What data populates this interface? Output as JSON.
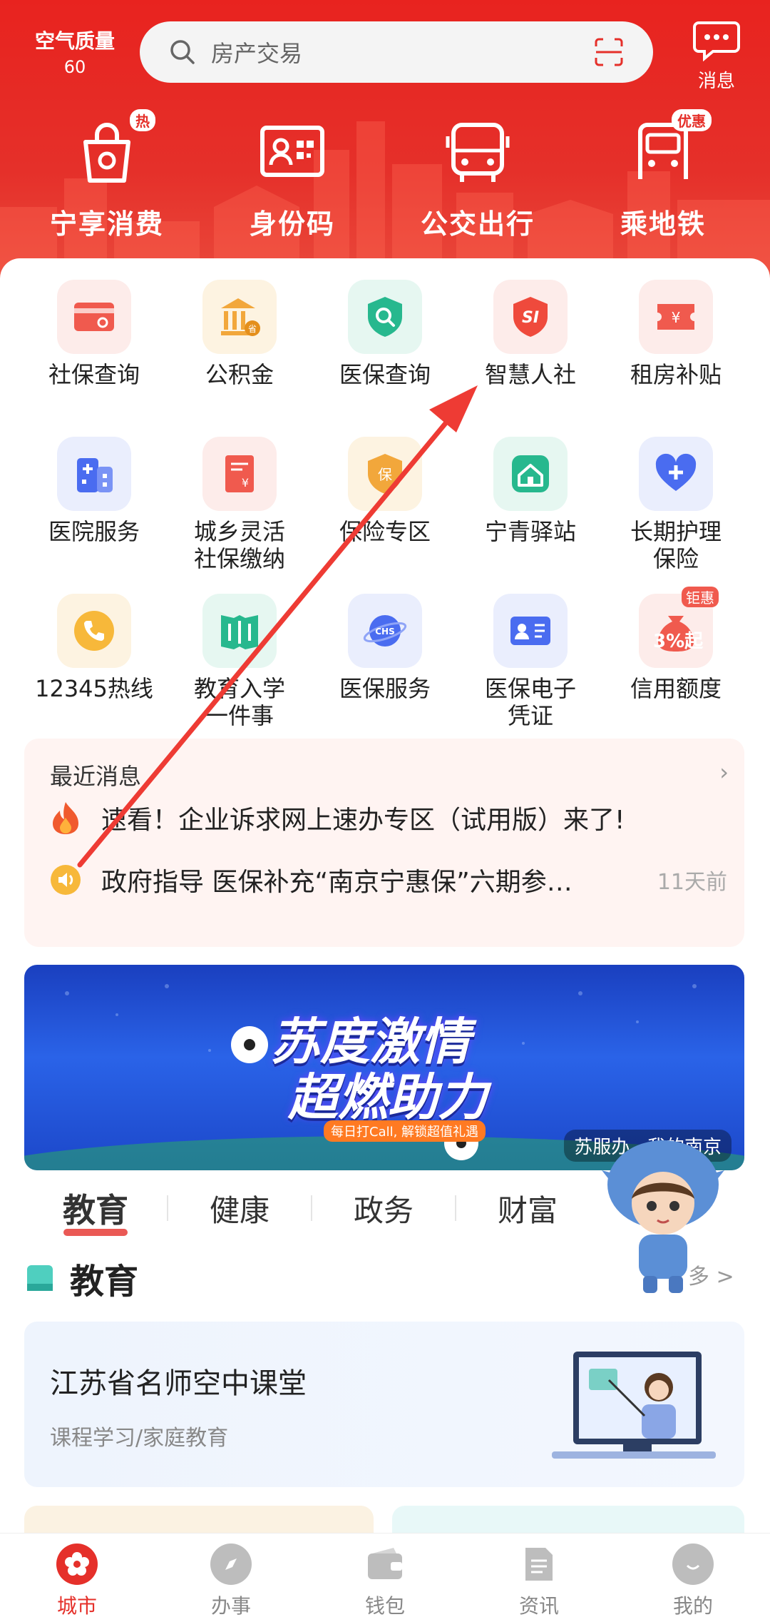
{
  "header": {
    "air_quality_label": "空气质量",
    "air_quality_value": "60",
    "search_placeholder": "房产交易",
    "message_label": "消息",
    "quick_actions": [
      {
        "label": "宁享消费",
        "icon": "shopping-bag-icon",
        "badge": "热"
      },
      {
        "label": "身份码",
        "icon": "id-card-icon",
        "badge": ""
      },
      {
        "label": "公交出行",
        "icon": "bus-icon",
        "badge": ""
      },
      {
        "label": "乘地铁",
        "icon": "metro-icon",
        "badge": "优惠"
      }
    ]
  },
  "services": [
    {
      "label": "社保查询",
      "icon": "card-icon",
      "bg": "#fdecea",
      "fg": "#f05a4e"
    },
    {
      "label": "公积金",
      "icon": "bank-icon",
      "bg": "#fdf3e1",
      "fg": "#f2a73b"
    },
    {
      "label": "医保查询",
      "icon": "shield-search-icon",
      "bg": "#e6f7f1",
      "fg": "#27b88e"
    },
    {
      "label": "智慧人社",
      "icon": "si-shield-icon",
      "bg": "#fdecea",
      "fg": "#ef4a3c"
    },
    {
      "label": "租房补贴",
      "icon": "ticket-icon",
      "bg": "#fdecea",
      "fg": "#f05a4e"
    },
    {
      "label": "医院服务",
      "icon": "hospital-icon",
      "bg": "#eaeefd",
      "fg": "#4a6cf0"
    },
    {
      "label": "城乡灵活\n社保缴纳",
      "icon": "bill-icon",
      "bg": "#fdecea",
      "fg": "#f05a4e"
    },
    {
      "label": "保险专区",
      "icon": "insurance-shield-icon",
      "bg": "#fdf3e1",
      "fg": "#f2a73b"
    },
    {
      "label": "宁青驿站",
      "icon": "house-icon",
      "bg": "#e6f7f1",
      "fg": "#27b88e"
    },
    {
      "label": "长期护理\n保险",
      "icon": "heart-plus-icon",
      "bg": "#eaeefd",
      "fg": "#4a6cf0"
    },
    {
      "label": "12345热线",
      "icon": "phone-icon",
      "bg": "#fdf3e1",
      "fg": "#f2a73b"
    },
    {
      "label": "教育入学\n一件事",
      "icon": "book-icon",
      "bg": "#e6f7f1",
      "fg": "#27b88e"
    },
    {
      "label": "医保服务",
      "icon": "chs-planet-icon",
      "bg": "#eaeefd",
      "fg": "#4a6cf0"
    },
    {
      "label": "医保电子\n凭证",
      "icon": "id-badge-icon",
      "bg": "#eaeefd",
      "fg": "#4a6cf0"
    },
    {
      "label": "信用额度",
      "icon": "money-bag-icon",
      "bg": "#fdecea",
      "fg": "#f05a4e",
      "badge": "钜惠",
      "inner": "3%起"
    }
  ],
  "news": {
    "title": "最近消息",
    "items": [
      {
        "icon": "fire-icon",
        "text": "速看！企业诉求网上速办专区（试用版）来了!",
        "time": ""
      },
      {
        "icon": "speaker-icon",
        "text": "政府指导 医保补充“南京宁惠保”六期参…",
        "time": "11天前"
      }
    ]
  },
  "banner": {
    "line1": "苏度激情",
    "line2": "超燃助力",
    "sub": "每日打Call, 解锁超值礼遇",
    "tag": "苏服办 · 我的南京"
  },
  "tabs": [
    "教育",
    "健康",
    "政务",
    "财富"
  ],
  "section": {
    "title": "教育",
    "more": "多 >"
  },
  "course": {
    "title": "江苏省名师空中课堂",
    "subtitle": "课程学习/家庭教育"
  },
  "tabbar": [
    {
      "label": "城市",
      "icon": "city-flower-icon",
      "active": true
    },
    {
      "label": "办事",
      "icon": "compass-icon",
      "active": false
    },
    {
      "label": "钱包",
      "icon": "wallet-icon",
      "active": false
    },
    {
      "label": "资讯",
      "icon": "document-icon",
      "active": false
    },
    {
      "label": "我的",
      "icon": "smile-icon",
      "active": false
    }
  ],
  "colors": {
    "brand": "#e5302a",
    "arrow": "#ee3b34"
  }
}
